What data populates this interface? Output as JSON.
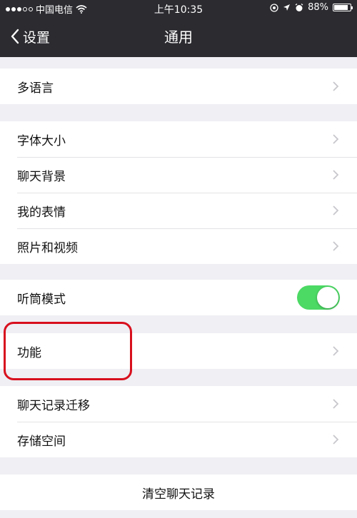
{
  "status_bar": {
    "carrier": "中国电信",
    "time": "上午10:35",
    "battery": "88%",
    "battery_level": 0.88
  },
  "nav": {
    "back_label": "设置",
    "title": "通用"
  },
  "groups": {
    "language": {
      "label": "多语言"
    },
    "display": {
      "font_size": "字体大小",
      "chat_background": "聊天背景",
      "my_stickers": "我的表情",
      "photos_videos": "照片和视频"
    },
    "earpiece": {
      "label": "听筒模式",
      "enabled": true
    },
    "features": {
      "label": "功能"
    },
    "storage": {
      "chat_migration": "聊天记录迁移",
      "storage_space": "存储空间"
    },
    "clear": {
      "label": "清空聊天记录"
    }
  },
  "colors": {
    "navbar": "#2b2b30",
    "background": "#efeff4",
    "toggle_on": "#4cd964",
    "highlight": "#d8101e"
  },
  "icons": [
    "wifi-icon",
    "location-icon",
    "alarm-icon",
    "back-chevron-icon",
    "chevron-right-icon"
  ]
}
